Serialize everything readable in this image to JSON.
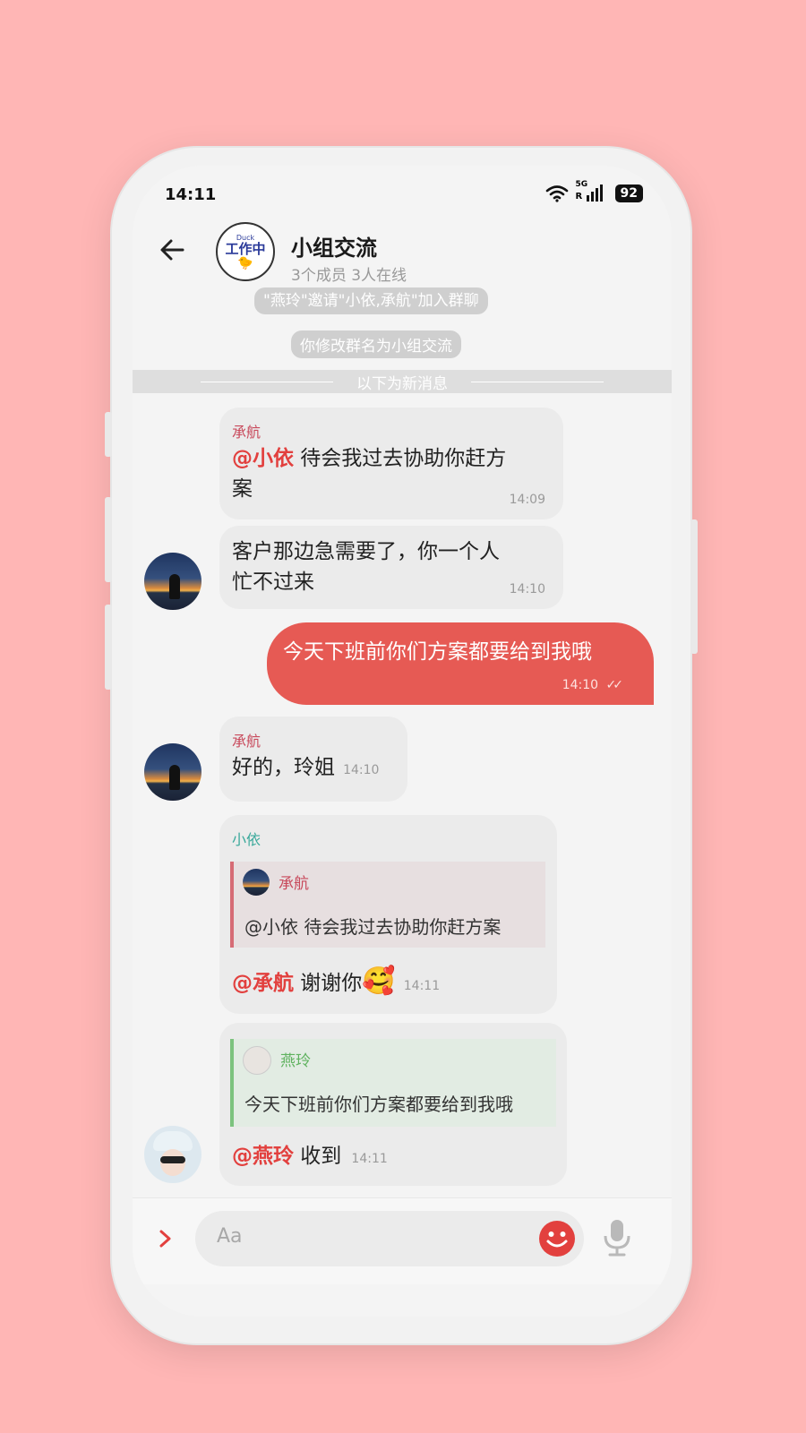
{
  "status_bar": {
    "time": "14:11",
    "network": "5G",
    "roaming": "R",
    "battery": "92"
  },
  "header": {
    "group_name": "小组交流",
    "group_subtitle": "3个成员 3人在线",
    "avatar_text_top": "Duck",
    "avatar_text": "工作中"
  },
  "system_messages": [
    "\"燕玲\"邀请\"小依,承航\"加入群聊",
    "你修改群名为小组交流"
  ],
  "new_messages_divider": "以下为新消息",
  "messages": [
    {
      "sender": "承航",
      "mention": "@小依",
      "text_line1": " 待会我过去协助你赶方",
      "text_line2": "案",
      "time": "14:09"
    },
    {
      "line1": "客户那边急需要了，你一个人",
      "line2": "忙不过来",
      "time": "14:10"
    },
    {
      "text": "今天下班前你们方案都要给到我哦",
      "time": "14:10",
      "check": "✓✓"
    },
    {
      "sender": "承航",
      "text": "好的，玲姐",
      "time": "14:10"
    },
    {
      "sender": "小依",
      "quote_name": "承航",
      "quote_text": "@小依  待会我过去协助你赶方案",
      "mention": "@承航",
      "text": " 谢谢你",
      "emoji": "🥰",
      "time": "14:11"
    },
    {
      "quote_name": "燕玲",
      "quote_text": "今天下班前你们方案都要给到我哦",
      "mention": "@燕玲",
      "text": " 收到",
      "time": "14:11"
    }
  ],
  "composer": {
    "placeholder": "Aa",
    "expand_icon": "chevron-right-icon",
    "emoji_icon": "smiley-icon",
    "mic_icon": "microphone-icon"
  },
  "colors": {
    "outgoing": "#e65a54",
    "mention": "#e2403e",
    "background": "#FFB6B5"
  }
}
